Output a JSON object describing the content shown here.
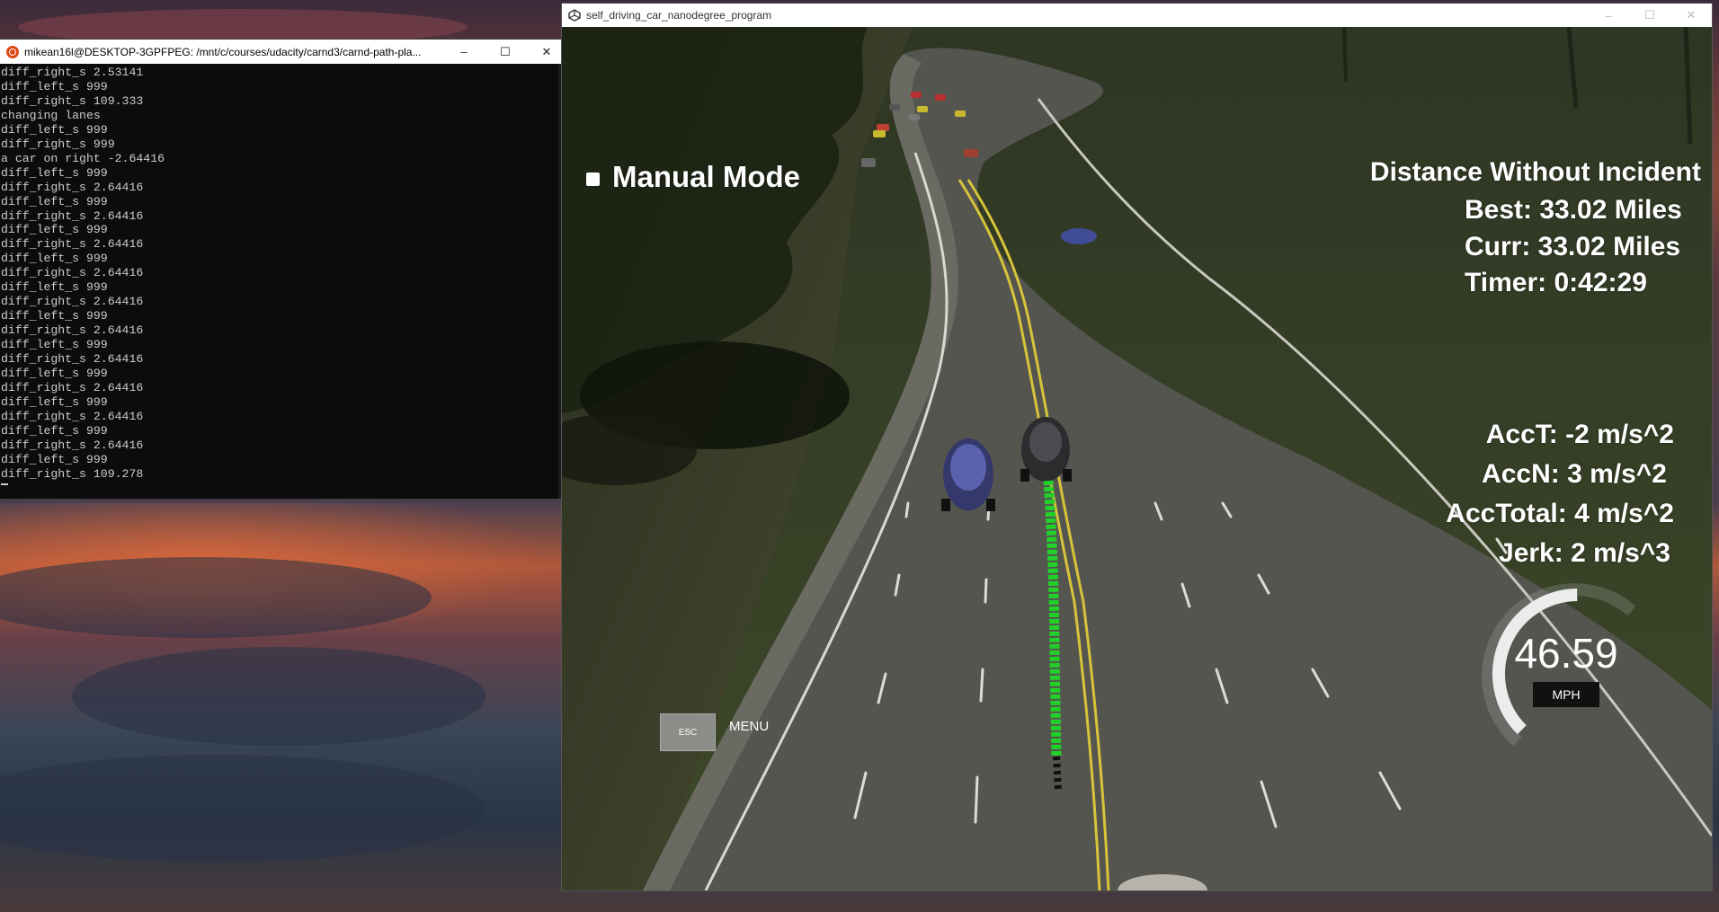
{
  "terminal": {
    "title": "mikean16l@DESKTOP-3GPFPEG: /mnt/c/courses/udacity/carnd3/carnd-path-pla...",
    "lines": [
      "diff_right_s 2.53141",
      "diff_left_s 999",
      "diff_right_s 109.333",
      "changing lanes",
      "diff_left_s 999",
      "diff_right_s 999",
      "a car on right -2.64416",
      "diff_left_s 999",
      "diff_right_s 2.64416",
      "diff_left_s 999",
      "diff_right_s 2.64416",
      "diff_left_s 999",
      "diff_right_s 2.64416",
      "diff_left_s 999",
      "diff_right_s 2.64416",
      "diff_left_s 999",
      "diff_right_s 2.64416",
      "diff_left_s 999",
      "diff_right_s 2.64416",
      "diff_left_s 999",
      "diff_right_s 2.64416",
      "diff_left_s 999",
      "diff_right_s 2.64416",
      "diff_left_s 999",
      "diff_right_s 2.64416",
      "diff_left_s 999",
      "diff_right_s 2.64416",
      "diff_left_s 999",
      "diff_right_s 109.278"
    ],
    "minimize": "–",
    "maximize": "☐",
    "close": "✕"
  },
  "simulator": {
    "title": "self_driving_car_nanodegree_program",
    "minimize": "–",
    "maximize": "☐",
    "close": "✕",
    "mode_label": "Manual Mode",
    "distance_title": "Distance Without Incident",
    "best": "Best: 33.02 Miles",
    "curr": "Curr: 33.02 Miles",
    "timer": "Timer: 0:42:29",
    "acc_t": "AccT: -2 m/s^2",
    "acc_n": "AccN: 3 m/s^2",
    "acc_total": "AccTotal: 4 m/s^2",
    "jerk": "Jerk: 2 m/s^3",
    "esc_label": "ESC",
    "menu_label": "MENU",
    "speed": "46.59",
    "speed_unit": "MPH",
    "speedometer_fraction": 0.35
  },
  "colors": {
    "grass": "#3a4428",
    "road": "#55554f",
    "lane_yellow": "#d6c43a",
    "path_green": "#22d02a",
    "terminal_bg": "#0c0c0c",
    "terminal_text": "#cccccc"
  }
}
